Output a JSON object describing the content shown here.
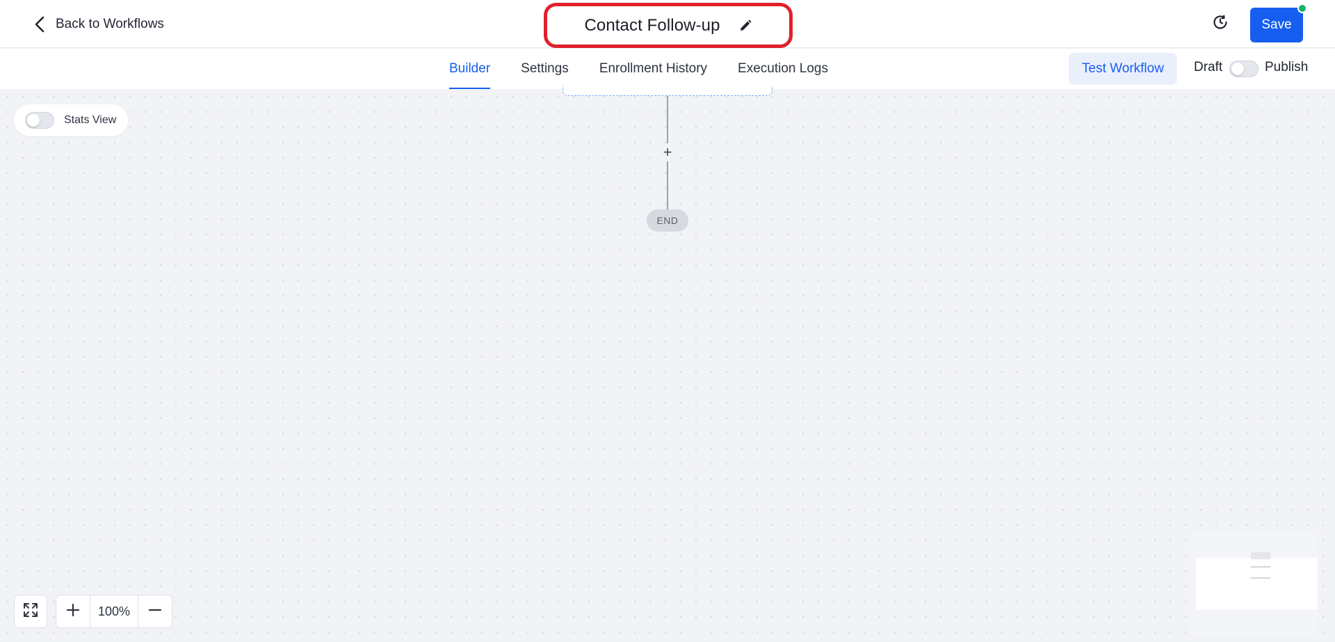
{
  "header": {
    "back_label": "Back to Workflows",
    "workflow_title": "Contact Follow-up",
    "save_label": "Save"
  },
  "tabs": [
    {
      "label": "Builder",
      "active": true
    },
    {
      "label": "Settings",
      "active": false
    },
    {
      "label": "Enrollment History",
      "active": false
    },
    {
      "label": "Execution Logs",
      "active": false
    }
  ],
  "actions": {
    "test_workflow_label": "Test Workflow",
    "draft_label": "Draft",
    "publish_label": "Publish",
    "published": false
  },
  "canvas": {
    "stats_view_label": "Stats View",
    "stats_view_enabled": false,
    "add_step_symbol": "+",
    "end_label": "END",
    "zoom_level": "100%"
  },
  "colors": {
    "accent": "#155eef",
    "status_dot": "#17b26a",
    "highlight_outline": "#e0202b"
  },
  "icons": {
    "back": "chevron-left-icon",
    "edit": "pencil-icon",
    "history": "history-clock-icon",
    "fit": "fit-screen-icon",
    "zoom_in": "plus-icon",
    "zoom_out": "minus-icon"
  }
}
